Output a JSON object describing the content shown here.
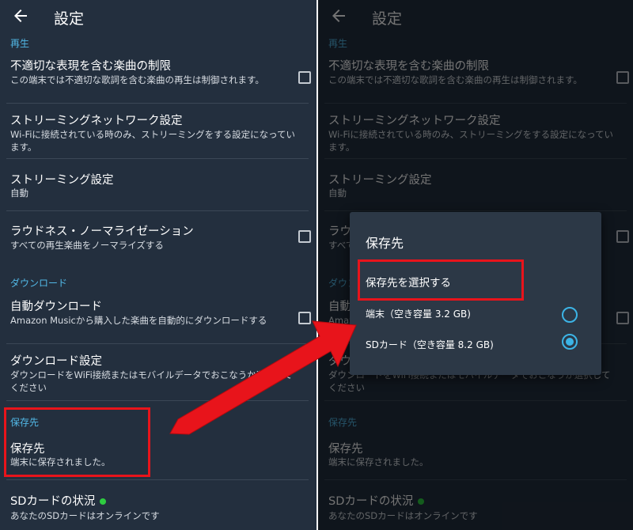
{
  "header": {
    "title": "設定"
  },
  "sections": {
    "playback": "再生",
    "download": "ダウンロード",
    "storage": "保存先"
  },
  "items": {
    "explicit": {
      "title": "不適切な表現を含む楽曲の制限",
      "sub": "この端末では不適切な歌詞を含む楽曲の再生は制御されます。"
    },
    "streaming_network": {
      "title": "ストリーミングネットワーク設定",
      "sub": "Wi-Fiに接続されている時のみ、ストリーミングをする設定になっています。"
    },
    "streaming": {
      "title": "ストリーミング設定",
      "sub": "自動"
    },
    "loudness": {
      "title": "ラウドネス・ノーマライゼーション",
      "sub": "すべての再生楽曲をノーマライズする"
    },
    "auto_download": {
      "title": "自動ダウンロード",
      "sub": "Amazon Musicから購入した楽曲を自動的にダウンロードする"
    },
    "download_settings": {
      "title": "ダウンロード設定",
      "sub": "ダウンロードをWiFi接続またはモバイルデータでおこなうか選択してください"
    },
    "storage": {
      "title": "保存先",
      "sub": "端末に保存されました。"
    },
    "sd_status": {
      "title": "SDカードの状況",
      "sub": "あなたのSDカードはオンラインです"
    }
  },
  "dialog": {
    "title": "保存先",
    "subtitle": "保存先を選択する",
    "options": [
      {
        "label": "端末（空き容量 3.2 GB)",
        "selected": false
      },
      {
        "label": "SDカード（空き容量 8.2 GB)",
        "selected": true
      }
    ]
  },
  "colors": {
    "background": "#232f3e",
    "accent": "#52b8e6",
    "highlight": "#e8141b",
    "online": "#2ecc40"
  }
}
